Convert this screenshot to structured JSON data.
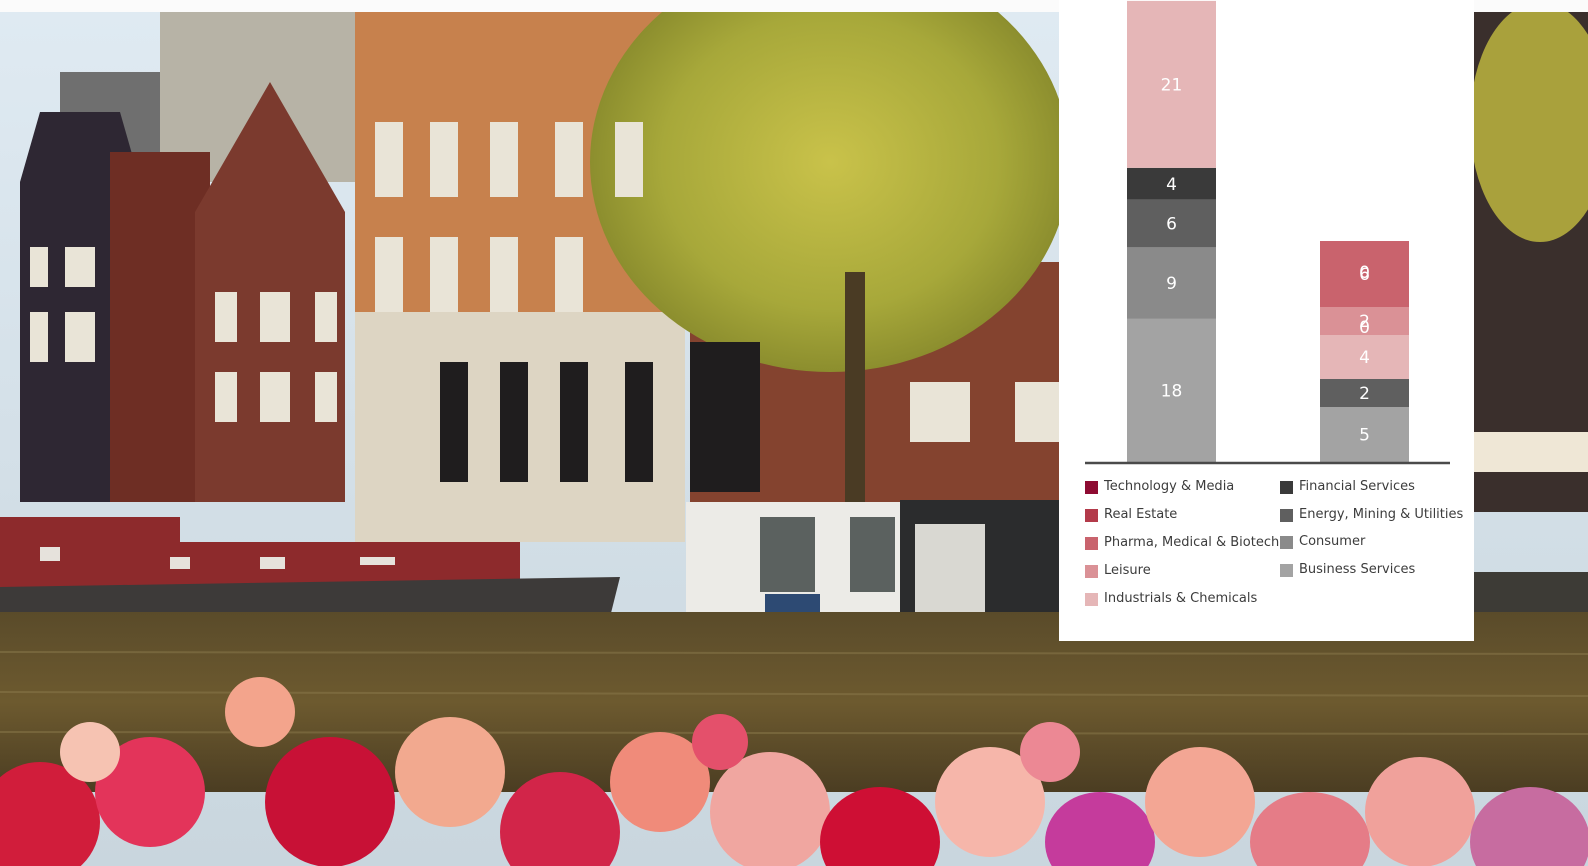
{
  "chart_data": {
    "type": "bar",
    "stacked": true,
    "categories": [
      "",
      ""
    ],
    "series": [
      {
        "name": "Business Services",
        "color": "#a3a3a3",
        "values": [
          18,
          5
        ]
      },
      {
        "name": "Consumer",
        "color": "#8a8a8a",
        "values": [
          9,
          0
        ]
      },
      {
        "name": "Energy, Mining & Utilities",
        "color": "#5f5f5f",
        "values": [
          6,
          2
        ]
      },
      {
        "name": "Financial Services",
        "color": "#3a3a3a",
        "values": [
          4,
          0
        ]
      },
      {
        "name": "Industrials & Chemicals",
        "color": "#e5b6b7",
        "values": [
          21,
          4
        ]
      },
      {
        "name": "Leisure",
        "color": "#da9196",
        "values": [
          0,
          2
        ]
      },
      {
        "name": "Pharma, Medical & Biotech",
        "color": "#c9636d",
        "values": [
          0,
          6
        ]
      },
      {
        "name": "Real Estate",
        "color": "#b33a4a",
        "values": [
          0,
          0
        ]
      },
      {
        "name": "Technology & Media",
        "color": "#8e0b32",
        "values": [
          0,
          0
        ]
      }
    ],
    "title": "",
    "xlabel": "",
    "ylabel": "",
    "legend_position": "bottom",
    "grid": false
  },
  "legend": {
    "left": [
      {
        "label": "Technology & Media",
        "color": "#8e0b32"
      },
      {
        "label": "Real Estate",
        "color": "#b33a4a"
      },
      {
        "label": "Pharma, Medical & Biotech",
        "color": "#c9636d"
      },
      {
        "label": "Leisure",
        "color": "#da9196"
      },
      {
        "label": "Industrials & Chemicals",
        "color": "#e5b6b7"
      }
    ],
    "right": [
      {
        "label": "Financial Services",
        "color": "#3a3a3a"
      },
      {
        "label": "Energy, Mining & Utilities",
        "color": "#5f5f5f"
      },
      {
        "label": "Consumer",
        "color": "#8a8a8a"
      },
      {
        "label": "Business Services",
        "color": "#a3a3a3"
      }
    ]
  }
}
